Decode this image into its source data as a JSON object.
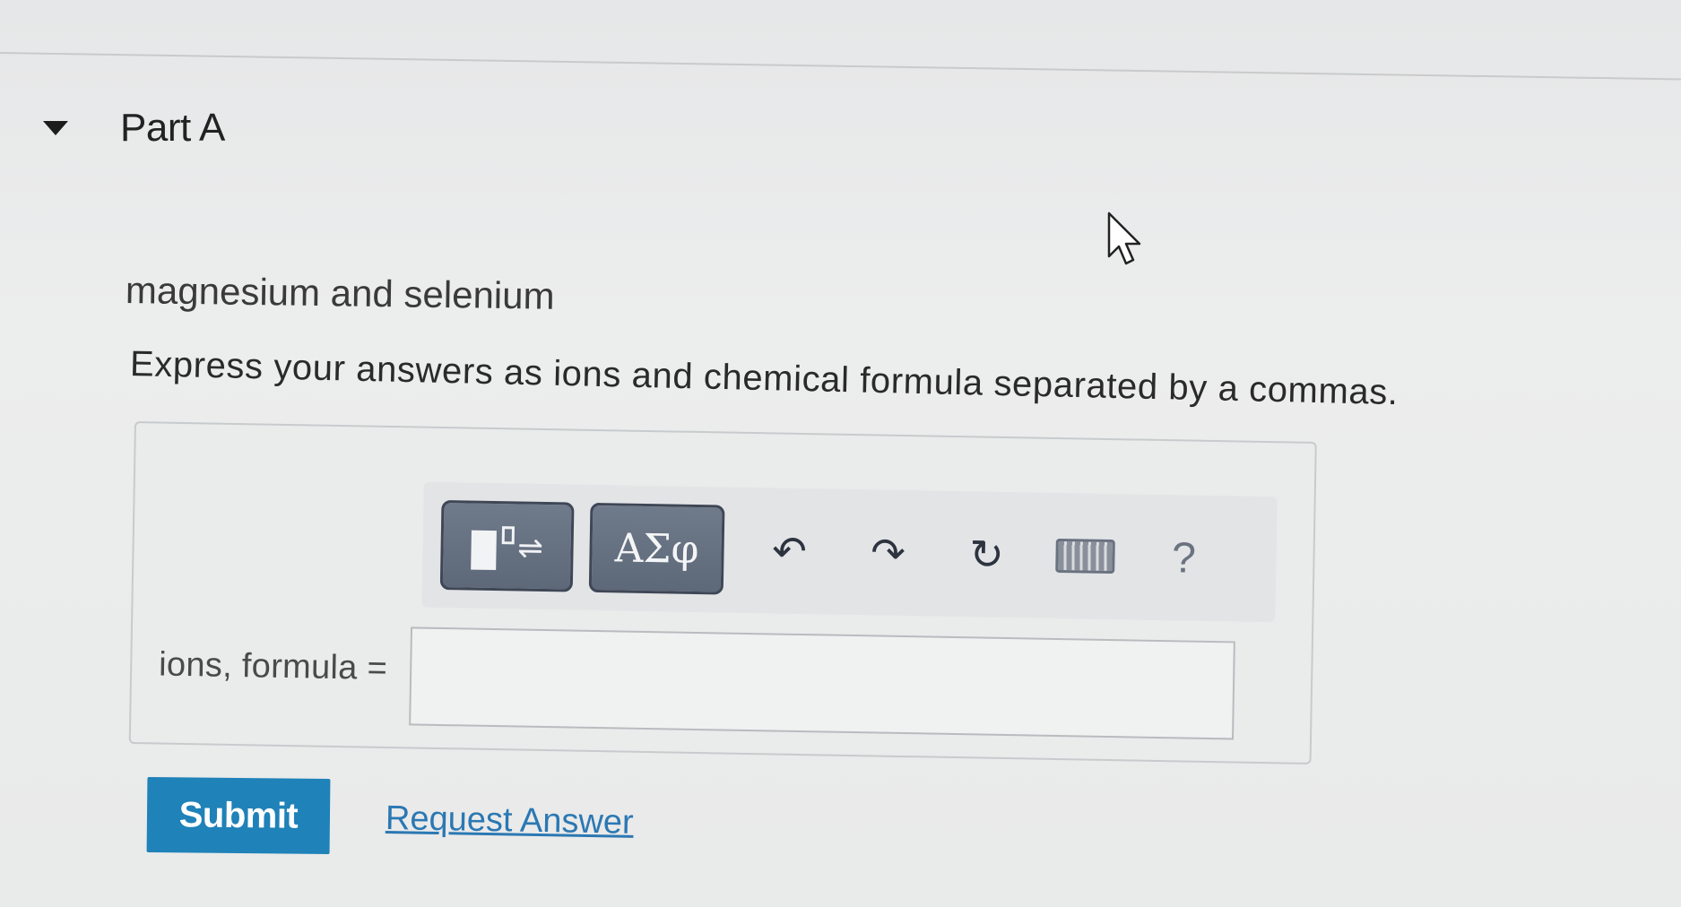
{
  "part": {
    "title": "Part A"
  },
  "question": {
    "text": "magnesium and selenium",
    "instruction": "Express your answers as ions and chemical formula separated by a commas."
  },
  "toolbar": {
    "buttons": [
      {
        "name": "templates",
        "icon": "template-icon"
      },
      {
        "name": "symbols",
        "label": "ΑΣφ"
      },
      {
        "name": "undo",
        "icon": "undo-icon"
      },
      {
        "name": "redo",
        "icon": "redo-icon"
      },
      {
        "name": "reset",
        "icon": "reset-icon"
      },
      {
        "name": "keyboard",
        "icon": "keyboard-icon"
      },
      {
        "name": "help",
        "label": "?"
      }
    ]
  },
  "answer": {
    "label": "ions, formula =",
    "value": "",
    "placeholder": ""
  },
  "actions": {
    "submit_label": "Submit",
    "request_label": "Request Answer"
  },
  "colors": {
    "submit_bg": "#1f82b8",
    "link": "#2b78b3",
    "toolbar_button": "#5d6878"
  }
}
